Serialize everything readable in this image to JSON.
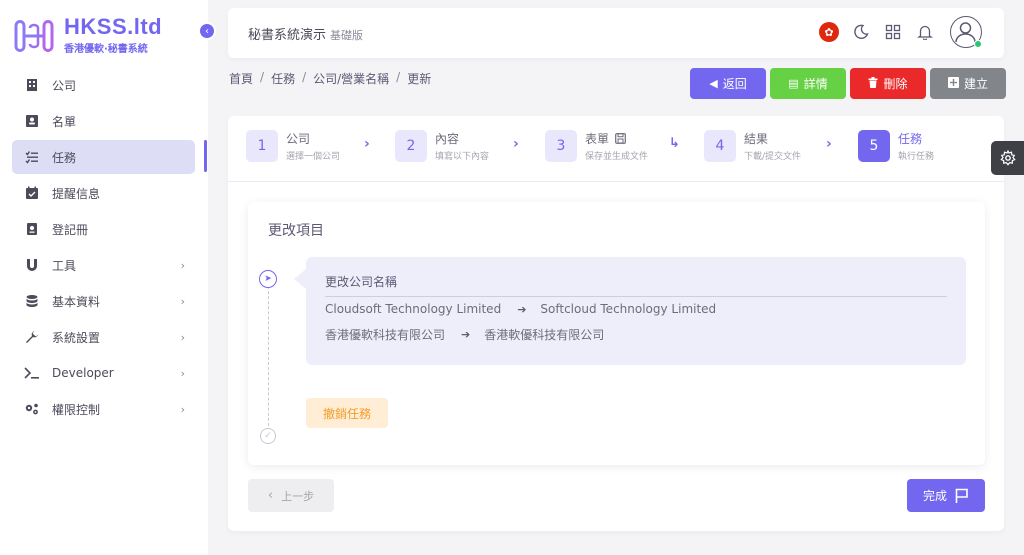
{
  "brand": {
    "name": "HKSS.ltd",
    "tagline": "香港優軟·秘書系統",
    "accent": "#7367f0"
  },
  "sidebar": {
    "items": [
      {
        "label": "公司",
        "icon": "building-icon",
        "has_children": false,
        "active": false
      },
      {
        "label": "名單",
        "icon": "contact-card-icon",
        "has_children": false,
        "active": false
      },
      {
        "label": "任務",
        "icon": "checklist-icon",
        "has_children": false,
        "active": true
      },
      {
        "label": "提醒信息",
        "icon": "calendar-check-icon",
        "has_children": false,
        "active": false
      },
      {
        "label": "登記冊",
        "icon": "register-book-icon",
        "has_children": false,
        "active": false
      },
      {
        "label": "工具",
        "icon": "magnet-icon",
        "has_children": true,
        "active": false
      },
      {
        "label": "基本資料",
        "icon": "database-icon",
        "has_children": true,
        "active": false
      },
      {
        "label": "系統設置",
        "icon": "wrench-icon",
        "has_children": true,
        "active": false
      },
      {
        "label": "Developer",
        "icon": "terminal-icon",
        "has_children": true,
        "active": false
      },
      {
        "label": "權限控制",
        "icon": "gears-icon",
        "has_children": true,
        "active": false
      }
    ]
  },
  "header": {
    "title": "秘書系統演示",
    "subtitle": "基礎版"
  },
  "breadcrumb": [
    "首頁",
    "任務",
    "公司/營業名稱",
    "更新"
  ],
  "actions": {
    "back": "返回",
    "detail": "詳情",
    "delete": "刪除",
    "create": "建立"
  },
  "steps": [
    {
      "num": "1",
      "title": "公司",
      "sub": "選擇一個公司"
    },
    {
      "num": "2",
      "title": "內容",
      "sub": "填寫以下內容"
    },
    {
      "num": "3",
      "title": "表單",
      "sub": "保存並生成文件"
    },
    {
      "num": "4",
      "title": "結果",
      "sub": "下載/提交文件"
    },
    {
      "num": "5",
      "title": "任務",
      "sub": "執行任務"
    }
  ],
  "panel": {
    "title": "更改項目",
    "change_title": "更改公司名稱",
    "changes": [
      {
        "from": "Cloudsoft Technology Limited",
        "to": "Softcloud Technology Limited"
      },
      {
        "from": "香港優軟科技有限公司",
        "to": "香港軟優科技有限公司"
      }
    ],
    "cancel_label": "撤銷任務"
  },
  "footer": {
    "prev": "上一步",
    "done": "完成"
  },
  "colors": {
    "detail": "#66d145",
    "delete": "#ea2a2a",
    "create": "#82868b",
    "warning_bg": "#ffedd5",
    "warning_text": "#f29d2a"
  }
}
